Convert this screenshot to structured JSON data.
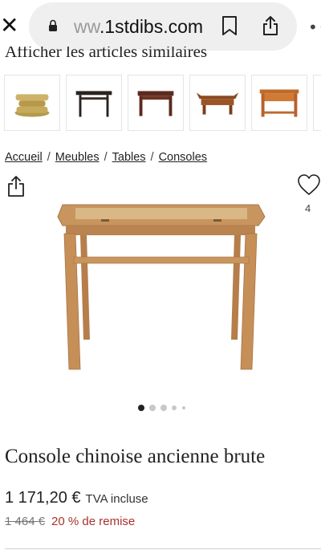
{
  "browser": {
    "url_prefix": "ww",
    "url_domain": ".1stdibs.com",
    "close_icon": "close-icon",
    "lock_icon": "lock-icon",
    "bookmark_icon": "bookmark-icon",
    "share_icon": "share-icon",
    "more_icon": "more-icon"
  },
  "similar": {
    "title": "Afficher les articles similaires",
    "items": [
      {
        "icon": "stone-stack-thumbnail"
      },
      {
        "icon": "dark-console-thumbnail"
      },
      {
        "icon": "mahogany-console-thumbnail"
      },
      {
        "icon": "altar-table-thumbnail"
      },
      {
        "icon": "desk-thumbnail"
      }
    ]
  },
  "breadcrumb": {
    "items": [
      "Accueil",
      "Meubles",
      "Tables",
      "Consoles"
    ],
    "separator": "/"
  },
  "actions": {
    "share_icon": "share-icon",
    "favorite_icon": "heart-icon",
    "favorite_count": "4"
  },
  "gallery": {
    "total_images": 5,
    "active_index": 0
  },
  "product": {
    "title": "Console chinoise ancienne brute",
    "price": "1 171,20 €",
    "tax_label": "TVA incluse",
    "old_price": "1 464 €",
    "discount": "20 % de remise"
  },
  "colors": {
    "discount": "#a8322f",
    "wood": "#c9955e"
  }
}
